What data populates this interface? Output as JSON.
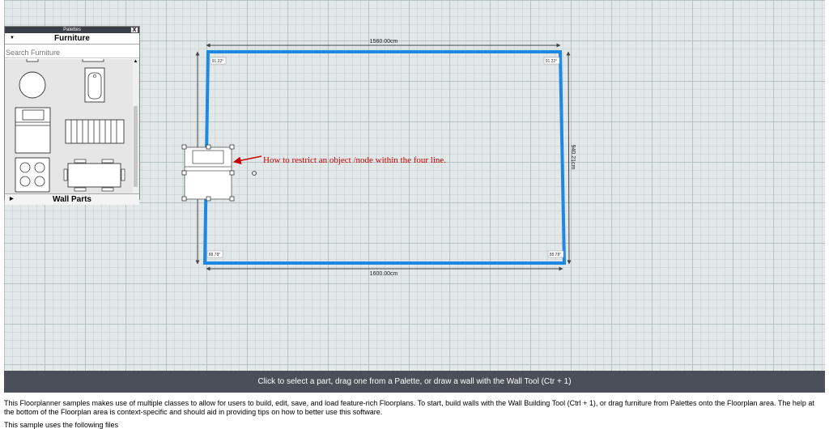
{
  "palette": {
    "title": "Palettes",
    "close_label": "X",
    "section_label": "Furniture",
    "search_placeholder": "Search Furniture",
    "footer_label": "Wall Parts"
  },
  "plan": {
    "top_dimension": "1560.00cm",
    "bottom_dimension": "1600.00cm",
    "right_dimension": "940.21cm",
    "angle_top_left": "91.22°",
    "angle_top_right": "91.22°",
    "angle_bottom_left": "88.78°",
    "angle_bottom_right": "88.78°",
    "annotation": "How to restrict an object /node within the four line.",
    "wall_color": "#1e88e5",
    "annotation_color": "#cc0000"
  },
  "help_text": "Click to select a part, drag one from a Palette, or draw a wall with the Wall Tool (Ctr + 1)",
  "description": "This Floorplanner samples makes use of multiple classes to allow for users to build, edit, save, and load feature-rich Floorplans. To start, build walls with the Wall Building Tool (Ctrl + 1), or drag furniture from Palettes onto the Floorplan area. The help at the bottom of the Floorplan area is context-specific and should aid in providing tips on how to better use this software.",
  "files_note": "This sample uses the following files"
}
